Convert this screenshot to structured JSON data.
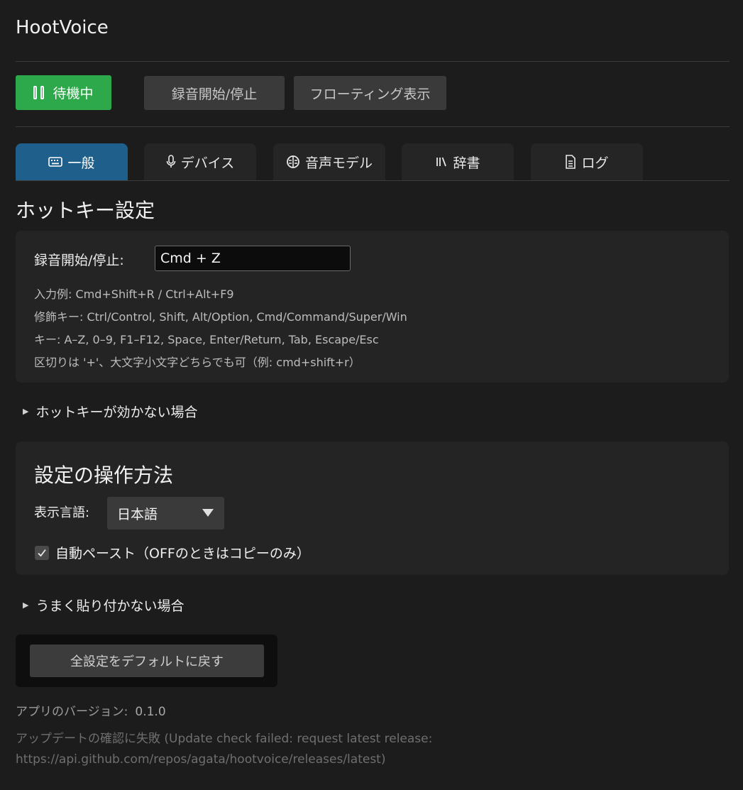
{
  "app": {
    "title": "HootVoice"
  },
  "toolbar": {
    "status_label": "待機中",
    "record_label": "録音開始/停止",
    "floating_label": "フローティング表示",
    "status_color": "#2da84a"
  },
  "tabs": [
    {
      "label": "一般",
      "icon": "keyboard-icon",
      "active": true
    },
    {
      "label": "デバイス",
      "icon": "microphone-icon",
      "active": false
    },
    {
      "label": "音声モデル",
      "icon": "brain-icon",
      "active": false
    },
    {
      "label": "辞書",
      "icon": "books-icon",
      "active": false
    },
    {
      "label": "ログ",
      "icon": "document-icon",
      "active": false
    }
  ],
  "hotkey": {
    "section_title": "ホットキー設定",
    "field_label": "録音開始/停止:",
    "field_value": "Cmd + Z",
    "hints": [
      "入力例: Cmd+Shift+R / Ctrl+Alt+F9",
      "修飾キー: Ctrl/Control, Shift, Alt/Option, Cmd/Command/Super/Win",
      "キー: A–Z, 0–9, F1–F12, Space, Enter/Return, Tab, Escape/Esc",
      "区切りは '+'、大文字小文字どちらでも可（例: cmd+shift+r）"
    ],
    "trouble_label": "ホットキーが効かない場合"
  },
  "operation": {
    "section_title": "設定の操作方法",
    "language_label": "表示言語:",
    "language_value": "日本語",
    "autopaste_label": "自動ペースト（OFFのときはコピーのみ）",
    "autopaste_checked": true,
    "trouble_label": "うまく貼り付かない場合"
  },
  "footer": {
    "reset_label": "全設定をデフォルトに戻す",
    "version_label": "アプリのバージョン:",
    "version_value": "0.1.0",
    "update_error": "アップデートの確認に失敗 (Update check failed: request latest release: https://api.github.com/repos/agata/hootvoice/releases/latest)"
  },
  "colors": {
    "accent_tab": "#1e5f8b",
    "background": "#1c1c1c"
  }
}
